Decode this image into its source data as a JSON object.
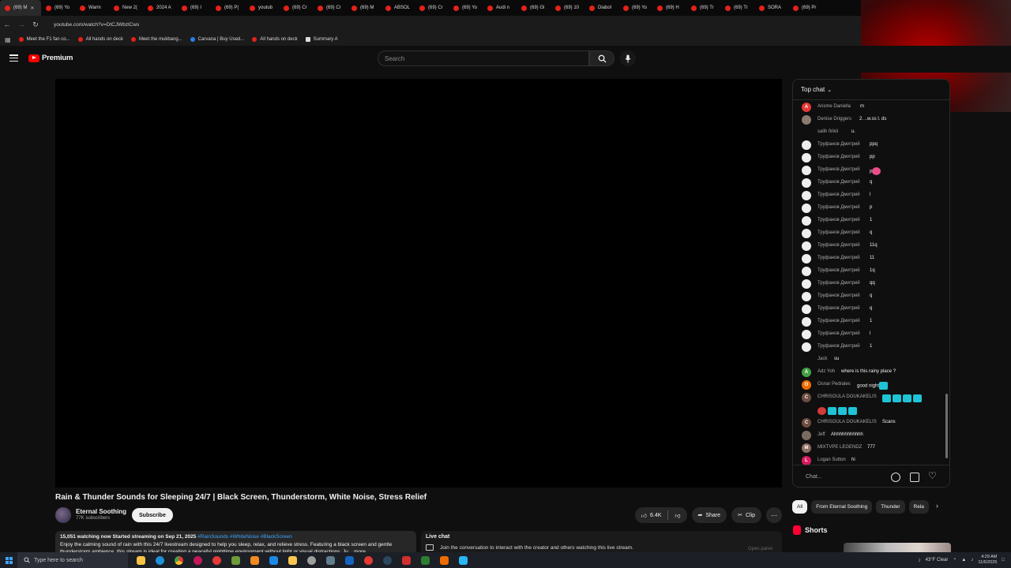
{
  "browser": {
    "tabs": [
      {
        "label": "(69) M"
      },
      {
        "label": "(69) Yo"
      },
      {
        "label": "Warm"
      },
      {
        "label": "New 2("
      },
      {
        "label": "2024 A"
      },
      {
        "label": "(69) I"
      },
      {
        "label": "(69) P("
      },
      {
        "label": "youtub"
      },
      {
        "label": "(69) Cr"
      },
      {
        "label": "(69) Cr"
      },
      {
        "label": "(69) M"
      },
      {
        "label": "ABSOL"
      },
      {
        "label": "(69) Cr"
      },
      {
        "label": "(69) Yo"
      },
      {
        "label": "Audi n"
      },
      {
        "label": "(69) Gl"
      },
      {
        "label": "(69) 10"
      },
      {
        "label": "Diabol"
      },
      {
        "label": "(69) Yo"
      },
      {
        "label": "(69) H"
      },
      {
        "label": "(69) Tr"
      },
      {
        "label": "(69) Tr"
      },
      {
        "label": "SORA"
      },
      {
        "label": "(69) Pr"
      }
    ],
    "url": "youtube.com/watch?v=DtCJWbzlCws",
    "bookmarks": [
      {
        "label": "Meet the F1 fan co...",
        "color": "red"
      },
      {
        "label": "All hands on deck",
        "color": "red"
      },
      {
        "label": "Meet the mukbang...",
        "color": "red"
      },
      {
        "label": "Carvana | Buy Used...",
        "color": "blue"
      },
      {
        "label": "All hands on deck",
        "color": "red"
      },
      {
        "label": "Summary A",
        "color": "white"
      }
    ]
  },
  "header": {
    "logo": "Premium",
    "search_placeholder": "Search"
  },
  "video": {
    "title": "Rain & Thunder Sounds for Sleeping 24/7 | Black Screen, Thunderstorm, White Noise, Stress Relief",
    "channel": "Eternal Soothing",
    "subscribers": "77K subscribers",
    "subscribe_label": "Subscribe",
    "likes": "6.4K",
    "share_label": "Share",
    "clip_label": "Clip",
    "description_meta": "15,051 watching now  Started streaming on Sep 21, 2025",
    "description_tags": "#RainSounds #WhiteNoise #BlackScreen",
    "description_text": "Enjoy the calming sound of rain with this 24/7 livestream designed to help you sleep, relax, and relieve stress. Featuring a black screen and gentle thunderstorm ambience, this stream is ideal for creating a peaceful nighttime environment without light or visual distractions. Ju ...more"
  },
  "livechat_box": {
    "heading": "Live chat",
    "text": "Join the conversation to interact with the creator and others watching this live stream.",
    "open_panel": "Open panel"
  },
  "chat": {
    "header": "Top chat",
    "input_placeholder": "Chat...",
    "messages": [
      {
        "author": "Arisme Daniella",
        "text": "m",
        "avatar": "A",
        "avatar_color": "#e53935",
        "text_x": 85
      },
      {
        "author": "Denise Driggers",
        "text": "2. ..w.ss l. ds",
        "avatar": "",
        "avatar_color": "#8a7a70",
        "text_x": 84
      },
      {
        "author": "salih firikli",
        "text": "u.",
        "avatar": "",
        "avatar_color": "#0f0f0f",
        "text_x": 74
      },
      {
        "author": "Труфанов Дмитрий",
        "text": "ppq",
        "avatar": "",
        "avatar_color": "#eeeeee",
        "text_x": 97
      },
      {
        "author": "Труфанов Дмитрий",
        "text": "pp",
        "avatar": "",
        "avatar_color": "#eeeeee",
        "text_x": 97
      },
      {
        "author": "Труфанов Дмитрий",
        "text": "p",
        "avatar": "",
        "avatar_color": "#eeeeee",
        "text_x": 97,
        "emoji": "pink"
      },
      {
        "author": "Труфанов Дмитрий",
        "text": "q",
        "avatar": "",
        "avatar_color": "#eeeeee",
        "text_x": 97
      },
      {
        "author": "Труфанов Дмитрий",
        "text": "l",
        "avatar": "",
        "avatar_color": "#eeeeee",
        "text_x": 97
      },
      {
        "author": "Труфанов Дмитрий",
        "text": "p",
        "avatar": "",
        "avatar_color": "#eeeeee",
        "text_x": 97
      },
      {
        "author": "Труфанов Дмитрий",
        "text": "1",
        "avatar": "",
        "avatar_color": "#eeeeee",
        "text_x": 97
      },
      {
        "author": "Труфанов Дмитрий",
        "text": "q",
        "avatar": "",
        "avatar_color": "#eeeeee",
        "text_x": 97
      },
      {
        "author": "Труфанов Дмитрий",
        "text": "11q",
        "avatar": "",
        "avatar_color": "#eeeeee",
        "text_x": 97
      },
      {
        "author": "Труфанов Дмитрий",
        "text": "11",
        "avatar": "",
        "avatar_color": "#eeeeee",
        "text_x": 97
      },
      {
        "author": "Труфанов Дмитрий",
        "text": "1q",
        "avatar": "",
        "avatar_color": "#eeeeee",
        "text_x": 97
      },
      {
        "author": "Труфанов Дмитрий",
        "text": "qq",
        "avatar": "",
        "avatar_color": "#eeeeee",
        "text_x": 97
      },
      {
        "author": "Труфанов Дмитрий",
        "text": "q",
        "avatar": "",
        "avatar_color": "#eeeeee",
        "text_x": 97
      },
      {
        "author": "Труфанов Дмитрий",
        "text": "q",
        "avatar": "",
        "avatar_color": "#eeeeee",
        "text_x": 97
      },
      {
        "author": "Труфанов Дмитрий",
        "text": "1",
        "avatar": "",
        "avatar_color": "#eeeeee",
        "text_x": 97
      },
      {
        "author": "Труфанов Дмитрий",
        "text": "l",
        "avatar": "",
        "avatar_color": "#eeeeee",
        "text_x": 97
      },
      {
        "author": "Труфанов Дмитрий",
        "text": "1",
        "avatar": "",
        "avatar_color": "#eeeeee",
        "text_x": 97
      },
      {
        "author": "Jack",
        "text": "su",
        "avatar": "",
        "avatar_color": "#0f0f0f",
        "text_x": 52
      },
      {
        "author": "Adz Yoh",
        "text": "where is this rainy place ?",
        "avatar": "A",
        "avatar_color": "#43a047",
        "text_x": 61
      },
      {
        "author": "Osnar Pedrales",
        "text": "good night",
        "avatar": "O",
        "avatar_color": "#ef6c00",
        "text_x": 81,
        "emoji": "cyan"
      },
      {
        "author": "CHRISOULA DOUKAKELIS",
        "text": "",
        "avatar": "C",
        "avatar_color": "#6d4c41",
        "text_x": 113,
        "emoji": "cyan4"
      },
      {
        "author": "",
        "text": "",
        "avatar": "",
        "avatar_color": "",
        "text_x": 31,
        "emoji": "row2"
      },
      {
        "author": "CHRISOULA DOUKAKELIS",
        "text": "Scans",
        "avatar": "C",
        "avatar_color": "#6d4c41",
        "text_x": 113
      },
      {
        "author": "Jeff",
        "text": "Ahhhhhhhhhhh",
        "avatar": "",
        "avatar_color": "#7a6a60",
        "text_x": 48
      },
      {
        "author": "MIXTVPE LEGENDZ",
        "text": "777",
        "avatar": "M",
        "avatar_color": "#8d6e63",
        "text_x": 94
      },
      {
        "author": "Logan Sutton",
        "text": "hi",
        "avatar": "L",
        "avatar_color": "#d81b60",
        "text_x": 74
      }
    ]
  },
  "chips": [
    {
      "label": "All",
      "active": true
    },
    {
      "label": "From Eternal Soothing",
      "active": false
    },
    {
      "label": "Thunder",
      "active": false
    },
    {
      "label": "Rela",
      "active": false
    }
  ],
  "shorts_label": "Shorts",
  "taskbar": {
    "search_placeholder": "Type here to search",
    "weather": "43°F  Clear",
    "time": "4:29 AM",
    "date": "11/6/2025"
  }
}
